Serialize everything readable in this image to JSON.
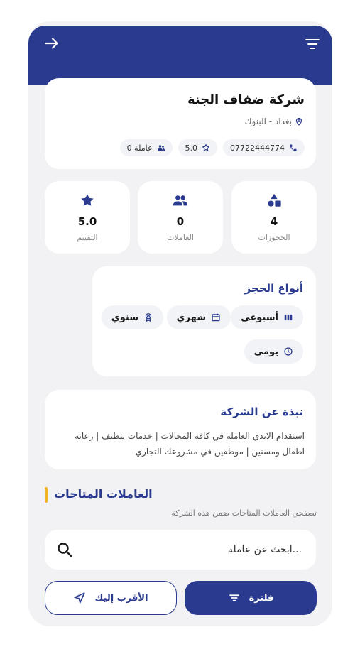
{
  "company": {
    "name": "شركة ضفاف الجنة",
    "location": "بغداد - البنوك",
    "phone": "07722444774",
    "rating": "5.0",
    "workers": "عاملة 0"
  },
  "stats": [
    {
      "value": "4",
      "label": "الحجوزات"
    },
    {
      "value": "0",
      "label": "العاملات"
    },
    {
      "value": "5.0",
      "label": "التقييم"
    }
  ],
  "booking_types": {
    "title": "أنواع الحجز",
    "weekly": "أسبوعي",
    "monthly": "شهري",
    "yearly": "سنوي",
    "daily": "يومي"
  },
  "about": {
    "title": "نبذة عن الشركة",
    "text": "استقدام الايدي العاملة في كافة المجالات | خدمات تنظيف | رعاية اطفال ومسنين | موظفين في مشروعك التجاري"
  },
  "available": {
    "title": "العاملات المتاحات",
    "subtitle": "تصفحي العاملات المتاحات ضمن هذه الشركة"
  },
  "search": {
    "placeholder": "...ابحث عن عاملة"
  },
  "buttons": {
    "filter": "فلترة",
    "nearest": "الأقرب إليك"
  },
  "colors": {
    "primary": "#2a3b8f",
    "accent": "#f0b429",
    "background": "#f2f2f4"
  }
}
